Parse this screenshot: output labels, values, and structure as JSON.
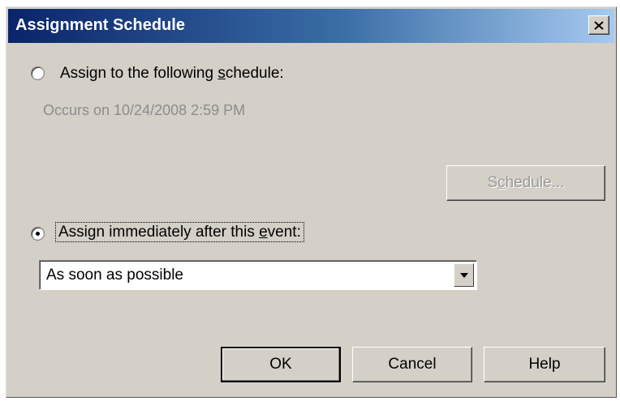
{
  "window": {
    "title": "Assignment Schedule"
  },
  "option_schedule": {
    "label_pre": "Assign to the following ",
    "label_key": "s",
    "label_post": "chedule:",
    "selected": false,
    "occurs_text": "Occurs on 10/24/2008 2:59 PM",
    "schedule_button": {
      "pre": "S",
      "key": "c",
      "post": "hedule...",
      "enabled": false
    }
  },
  "option_event": {
    "label_pre": "Assign immediately after this ",
    "label_key": "e",
    "label_post": "vent:",
    "selected": true
  },
  "event_select": {
    "value": "As soon as possible"
  },
  "buttons": {
    "ok": "OK",
    "cancel": "Cancel",
    "help": "Help"
  },
  "icons": {
    "close": "close-icon",
    "dropdown": "chevron-down-icon"
  }
}
